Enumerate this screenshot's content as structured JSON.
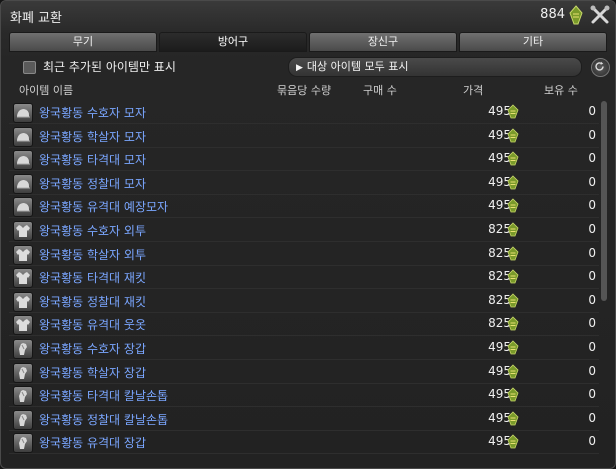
{
  "window": {
    "title": "화폐 교환",
    "currency_count": "884"
  },
  "tabs": [
    {
      "label": "무기",
      "active": false
    },
    {
      "label": "방어구",
      "active": true
    },
    {
      "label": "장신구",
      "active": false
    },
    {
      "label": "기타",
      "active": false
    }
  ],
  "filter": {
    "checkbox_label": "최근 추가된 아이템만 표시",
    "show_all_label": "대상 아이템 모두 표시"
  },
  "columns": {
    "name": "아이템 이름",
    "bundle_qty": "묶음당 수량",
    "buy_qty": "구매 수",
    "price": "가격",
    "owned": "보유 수"
  },
  "items": [
    {
      "name": "왕국황동 수호자 모자",
      "price": "495",
      "owned": "0",
      "icon": "hat-icon"
    },
    {
      "name": "왕국황동 학살자 모자",
      "price": "495",
      "owned": "0",
      "icon": "hat-icon"
    },
    {
      "name": "왕국황동 타격대 모자",
      "price": "495",
      "owned": "0",
      "icon": "hat-icon"
    },
    {
      "name": "왕국황동 정찰대 모자",
      "price": "495",
      "owned": "0",
      "icon": "hat-icon"
    },
    {
      "name": "왕국황동 유격대 예장모자",
      "price": "495",
      "owned": "0",
      "icon": "hat-icon"
    },
    {
      "name": "왕국황동 수호자 외투",
      "price": "825",
      "owned": "0",
      "icon": "coat-icon"
    },
    {
      "name": "왕국황동 학살자 외투",
      "price": "825",
      "owned": "0",
      "icon": "coat-icon"
    },
    {
      "name": "왕국황동 타격대 재킷",
      "price": "825",
      "owned": "0",
      "icon": "coat-icon"
    },
    {
      "name": "왕국황동 정찰대 재킷",
      "price": "825",
      "owned": "0",
      "icon": "coat-icon"
    },
    {
      "name": "왕국황동 유격대 웃옷",
      "price": "825",
      "owned": "0",
      "icon": "coat-icon"
    },
    {
      "name": "왕국황동 수호자 장갑",
      "price": "495",
      "owned": "0",
      "icon": "glove-icon"
    },
    {
      "name": "왕국황동 학살자 장갑",
      "price": "495",
      "owned": "0",
      "icon": "glove-icon"
    },
    {
      "name": "왕국황동 타격대 칼날손톱",
      "price": "495",
      "owned": "0",
      "icon": "glove-icon"
    },
    {
      "name": "왕국황동 정찰대 칼날손톱",
      "price": "495",
      "owned": "0",
      "icon": "glove-icon"
    },
    {
      "name": "왕국황동 유격대 장갑",
      "price": "495",
      "owned": "0",
      "icon": "glove-icon"
    }
  ],
  "colors": {
    "item_name": "#7aa6ff",
    "background": "#222222"
  }
}
